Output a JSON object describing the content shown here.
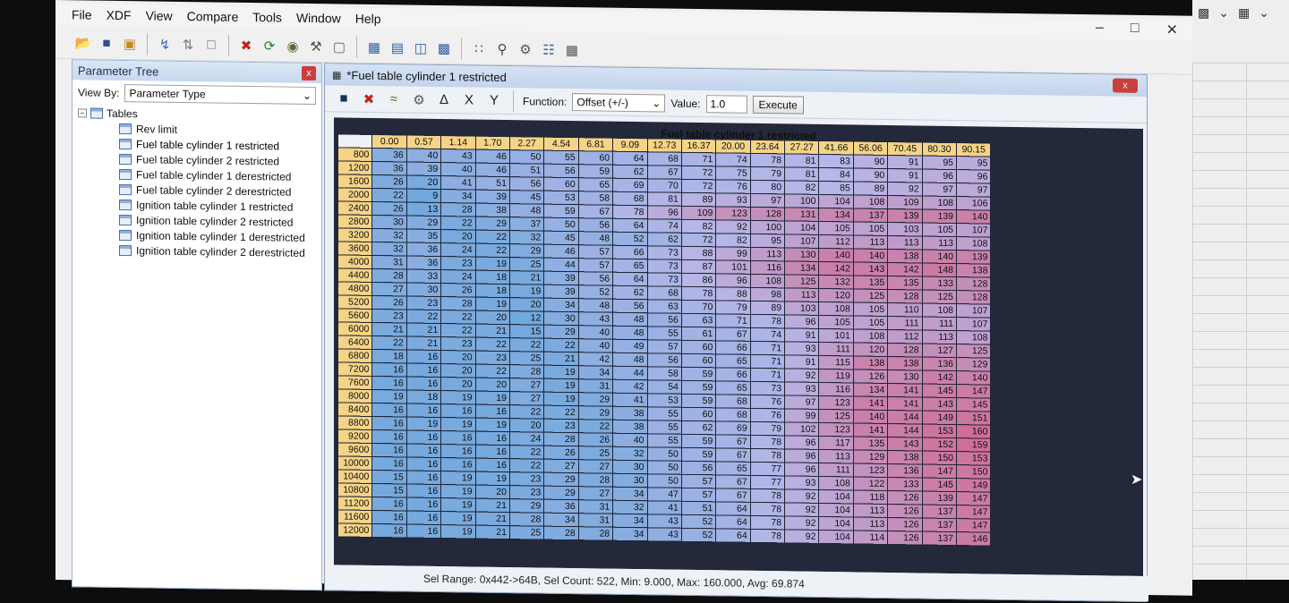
{
  "menubar": {
    "items": [
      "File",
      "XDF",
      "View",
      "Compare",
      "Tools",
      "Window",
      "Help"
    ]
  },
  "window_controls": {
    "minimize": "–",
    "maximize": "□",
    "close": "✕"
  },
  "toolbar": {
    "icons": [
      "open-folder-icon",
      "save-icon",
      "open-icon",
      "flash-icon",
      "compare-icon",
      "new-document-icon",
      "delete-icon",
      "refresh-icon",
      "checksum-icon",
      "wrench-icon",
      "page-icon",
      "view-table-icon",
      "view-list-icon",
      "view-graph-icon",
      "monitor-icon",
      "binary-icon",
      "search-icon",
      "settings-icon",
      "hierarchy-icon",
      "calculator-icon"
    ]
  },
  "tree": {
    "title": "Parameter Tree",
    "close_label": "x",
    "view_by_label": "View By:",
    "view_by_value": "Parameter Type",
    "root_label": "Tables",
    "items": [
      "Rev limit",
      "Fuel table cylinder 1 restricted",
      "Fuel table cylinder 2 restricted",
      "Fuel table cylinder 1 derestricted",
      "Fuel table cylinder 2 derestricted",
      "Ignition table cylinder 1 restricted",
      "Ignition table cylinder 2 restricted",
      "Ignition table cylinder 1 derestricted",
      "Ignition table cylinder 2 derestricted"
    ]
  },
  "table_window": {
    "title": "*Fuel table cylinder 1 restricted",
    "close_label": "x",
    "function_label": "Function:",
    "function_value": "Offset (+/-)",
    "value_label": "Value:",
    "value": "1.0",
    "execute_label": "Execute",
    "table_title": "Fuel table cylinder 1 restricted"
  },
  "table": {
    "col_headers": [
      "0.00",
      "0.57",
      "1.14",
      "1.70",
      "2.27",
      "4.54",
      "6.81",
      "9.09",
      "12.73",
      "16.37",
      "20.00",
      "23.64",
      "27.27",
      "41.66",
      "56.06",
      "70.45",
      "80.30",
      "90.15"
    ],
    "row_headers": [
      "800",
      "1200",
      "1600",
      "2000",
      "2400",
      "2800",
      "3200",
      "3600",
      "4000",
      "4400",
      "4800",
      "5200",
      "5600",
      "6000",
      "6400",
      "6800",
      "7200",
      "7600",
      "8000",
      "8400",
      "8800",
      "9200",
      "9600",
      "10000",
      "10400",
      "10800",
      "11200",
      "11600",
      "12000"
    ],
    "rows": [
      [
        "36",
        "40",
        "43",
        "46",
        "50",
        "55",
        "60",
        "64",
        "68",
        "71",
        "74",
        "78",
        "81",
        "83",
        "90",
        "91",
        "95",
        "95"
      ],
      [
        "36",
        "39",
        "40",
        "46",
        "51",
        "56",
        "59",
        "62",
        "67",
        "72",
        "75",
        "79",
        "81",
        "84",
        "90",
        "91",
        "96",
        "96"
      ],
      [
        "26",
        "20",
        "41",
        "51",
        "56",
        "60",
        "65",
        "69",
        "70",
        "72",
        "76",
        "80",
        "82",
        "85",
        "89",
        "92",
        "97",
        "97"
      ],
      [
        "22",
        "9",
        "34",
        "39",
        "45",
        "53",
        "58",
        "68",
        "81",
        "89",
        "93",
        "97",
        "100",
        "104",
        "108",
        "109",
        "108",
        "106"
      ],
      [
        "26",
        "13",
        "28",
        "38",
        "48",
        "59",
        "67",
        "78",
        "96",
        "109",
        "123",
        "128",
        "131",
        "134",
        "137",
        "139",
        "139",
        "140"
      ],
      [
        "30",
        "29",
        "22",
        "29",
        "37",
        "50",
        "56",
        "64",
        "74",
        "82",
        "92",
        "100",
        "104",
        "105",
        "105",
        "103",
        "105",
        "107"
      ],
      [
        "32",
        "35",
        "20",
        "22",
        "32",
        "45",
        "48",
        "52",
        "62",
        "72",
        "82",
        "95",
        "107",
        "112",
        "113",
        "113",
        "113",
        "108"
      ],
      [
        "32",
        "36",
        "24",
        "22",
        "29",
        "46",
        "57",
        "66",
        "73",
        "88",
        "99",
        "113",
        "130",
        "140",
        "140",
        "138",
        "140",
        "139"
      ],
      [
        "31",
        "36",
        "23",
        "19",
        "25",
        "44",
        "57",
        "65",
        "73",
        "87",
        "101",
        "116",
        "134",
        "142",
        "143",
        "142",
        "148",
        "138"
      ],
      [
        "28",
        "33",
        "24",
        "18",
        "21",
        "39",
        "56",
        "64",
        "73",
        "86",
        "96",
        "108",
        "125",
        "132",
        "135",
        "135",
        "133",
        "128"
      ],
      [
        "27",
        "30",
        "26",
        "18",
        "19",
        "39",
        "52",
        "62",
        "68",
        "78",
        "88",
        "98",
        "113",
        "120",
        "125",
        "128",
        "125",
        "128"
      ],
      [
        "26",
        "23",
        "28",
        "19",
        "20",
        "34",
        "48",
        "56",
        "63",
        "70",
        "79",
        "89",
        "103",
        "108",
        "105",
        "110",
        "108",
        "107"
      ],
      [
        "23",
        "22",
        "22",
        "20",
        "12",
        "30",
        "43",
        "48",
        "56",
        "63",
        "71",
        "78",
        "96",
        "105",
        "105",
        "111",
        "111",
        "107"
      ],
      [
        "21",
        "21",
        "22",
        "21",
        "15",
        "29",
        "40",
        "48",
        "55",
        "61",
        "67",
        "74",
        "91",
        "101",
        "108",
        "112",
        "113",
        "108"
      ],
      [
        "22",
        "21",
        "23",
        "22",
        "22",
        "22",
        "40",
        "49",
        "57",
        "60",
        "66",
        "71",
        "93",
        "111",
        "120",
        "128",
        "127",
        "125"
      ],
      [
        "18",
        "16",
        "20",
        "23",
        "25",
        "21",
        "42",
        "48",
        "56",
        "60",
        "65",
        "71",
        "91",
        "115",
        "138",
        "138",
        "136",
        "129"
      ],
      [
        "16",
        "16",
        "20",
        "22",
        "28",
        "19",
        "34",
        "44",
        "58",
        "59",
        "66",
        "71",
        "92",
        "119",
        "126",
        "130",
        "142",
        "140"
      ],
      [
        "16",
        "16",
        "20",
        "20",
        "27",
        "19",
        "31",
        "42",
        "54",
        "59",
        "65",
        "73",
        "93",
        "116",
        "134",
        "141",
        "145",
        "147"
      ],
      [
        "19",
        "18",
        "19",
        "19",
        "27",
        "19",
        "29",
        "41",
        "53",
        "59",
        "68",
        "76",
        "97",
        "123",
        "141",
        "141",
        "143",
        "145"
      ],
      [
        "16",
        "16",
        "16",
        "16",
        "22",
        "22",
        "29",
        "38",
        "55",
        "60",
        "68",
        "76",
        "99",
        "125",
        "140",
        "144",
        "149",
        "151"
      ],
      [
        "16",
        "19",
        "19",
        "19",
        "20",
        "23",
        "22",
        "38",
        "55",
        "62",
        "69",
        "79",
        "102",
        "123",
        "141",
        "144",
        "153",
        "160"
      ],
      [
        "16",
        "16",
        "16",
        "16",
        "24",
        "28",
        "26",
        "40",
        "55",
        "59",
        "67",
        "78",
        "96",
        "117",
        "135",
        "143",
        "152",
        "159"
      ],
      [
        "16",
        "16",
        "16",
        "16",
        "22",
        "26",
        "25",
        "32",
        "50",
        "59",
        "67",
        "78",
        "96",
        "113",
        "129",
        "138",
        "150",
        "153"
      ],
      [
        "16",
        "16",
        "16",
        "16",
        "22",
        "27",
        "27",
        "30",
        "50",
        "56",
        "65",
        "77",
        "96",
        "111",
        "123",
        "136",
        "147",
        "150"
      ],
      [
        "15",
        "16",
        "19",
        "19",
        "23",
        "29",
        "28",
        "30",
        "50",
        "57",
        "67",
        "77",
        "93",
        "108",
        "122",
        "133",
        "145",
        "149"
      ],
      [
        "15",
        "16",
        "19",
        "20",
        "23",
        "29",
        "27",
        "34",
        "47",
        "57",
        "67",
        "78",
        "92",
        "104",
        "118",
        "126",
        "139",
        "147"
      ],
      [
        "16",
        "16",
        "19",
        "21",
        "29",
        "36",
        "31",
        "32",
        "41",
        "51",
        "64",
        "78",
        "92",
        "104",
        "113",
        "126",
        "137",
        "147"
      ],
      [
        "16",
        "16",
        "19",
        "21",
        "28",
        "34",
        "31",
        "34",
        "43",
        "52",
        "64",
        "78",
        "92",
        "104",
        "113",
        "126",
        "137",
        "147"
      ],
      [
        "16",
        "16",
        "19",
        "21",
        "25",
        "28",
        "28",
        "34",
        "43",
        "52",
        "64",
        "78",
        "92",
        "104",
        "114",
        "126",
        "137",
        "146"
      ]
    ]
  },
  "status": {
    "text": "Sel Range: 0x442->64B, Sel Count: 522, Min: 9.000, Max: 160.000, Avg: 69.874"
  },
  "colors": {
    "header": "#f5d487",
    "low": "#6fa8dc",
    "mid": "#b7b7e8",
    "high": "#d07a9c",
    "grid_bg": "#23283a"
  }
}
